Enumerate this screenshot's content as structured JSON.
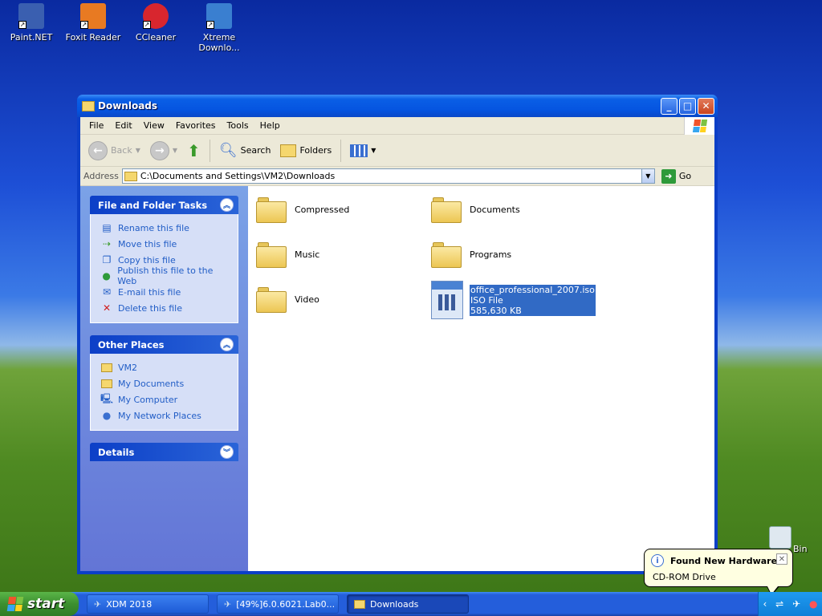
{
  "desktop": {
    "icons": [
      {
        "label": "Paint.NET",
        "icon": "paintnet-icon",
        "color": "#3a5fb0"
      },
      {
        "label": "Foxit Reader",
        "icon": "foxit-reader-icon",
        "color": "#e87a22"
      },
      {
        "label": "CCleaner",
        "icon": "ccleaner-icon",
        "color": "#d8262e"
      },
      {
        "label": "Xtreme Downlo...",
        "icon": "xtreme-download-icon",
        "color": "#3a7fd0"
      }
    ],
    "recycle_bin_label": "Bin"
  },
  "window": {
    "title": "Downloads",
    "menu": [
      "File",
      "Edit",
      "View",
      "Favorites",
      "Tools",
      "Help"
    ],
    "toolbar": {
      "back": "Back",
      "search": "Search",
      "folders": "Folders"
    },
    "address": {
      "label": "Address",
      "value": "C:\\Documents and Settings\\VM2\\Downloads",
      "go": "Go"
    },
    "tasks": {
      "file_folder_tasks": {
        "title": "File and Folder Tasks",
        "items": [
          "Rename this file",
          "Move this file",
          "Copy this file",
          "Publish this file to the Web",
          "E-mail this file",
          "Delete this file"
        ]
      },
      "other_places": {
        "title": "Other Places",
        "items": [
          "VM2",
          "My Documents",
          "My Computer",
          "My Network Places"
        ]
      },
      "details": {
        "title": "Details"
      }
    },
    "files": [
      {
        "name": "Compressed",
        "type": "folder"
      },
      {
        "name": "Documents",
        "type": "folder"
      },
      {
        "name": "Music",
        "type": "folder"
      },
      {
        "name": "Programs",
        "type": "folder"
      },
      {
        "name": "Video",
        "type": "folder"
      },
      {
        "name": "office_professional_2007.iso",
        "type": "ISO File",
        "size": "585,630 KB",
        "selected": true
      }
    ]
  },
  "balloon": {
    "title": "Found New Hardware",
    "message": "CD-ROM Drive"
  },
  "taskbar": {
    "start": "start",
    "buttons": [
      {
        "label": "XDM 2018",
        "active": false
      },
      {
        "label": "[49%]6.0.6021.Lab0...",
        "active": false
      },
      {
        "label": "Downloads",
        "active": true
      }
    ]
  }
}
